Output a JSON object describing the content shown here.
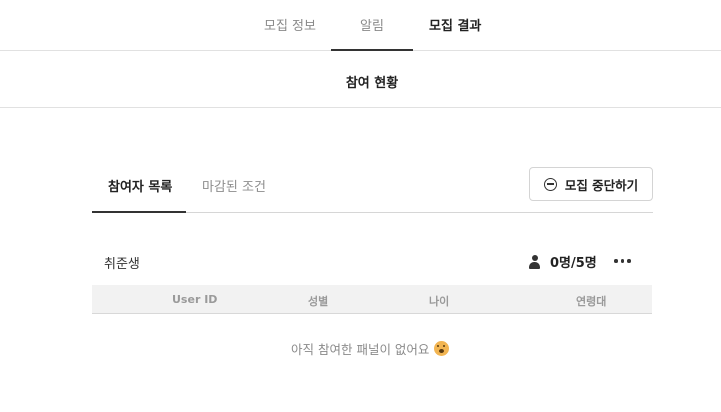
{
  "top_tabs": [
    {
      "label": "모집 정보",
      "active": false
    },
    {
      "label": "알림",
      "active": false
    },
    {
      "label": "모집 결과",
      "active": true
    }
  ],
  "subheader": {
    "title": "참여 현황"
  },
  "inner_tabs": [
    {
      "label": "참여자 목록",
      "active": true
    },
    {
      "label": "마감된 조건",
      "active": false
    }
  ],
  "stop_button": {
    "label": "모집 중단하기",
    "icon": "minus-circle-icon"
  },
  "group": {
    "label": "취준생",
    "count_text": "0명/5명",
    "count_icon": "person-icon",
    "more_icon": "more-horizontal-icon"
  },
  "table": {
    "columns": [
      "User ID",
      "성별",
      "나이",
      "연령대"
    ],
    "rows": [],
    "empty_message": "아직 참여한 패널이 없어요",
    "empty_icon": "sad-face-emoji-icon"
  },
  "colors": {
    "text_primary": "#222222",
    "text_muted": "#8a8a8a",
    "divider": "#e1e1e1",
    "table_header_bg": "#f2f2f2"
  }
}
